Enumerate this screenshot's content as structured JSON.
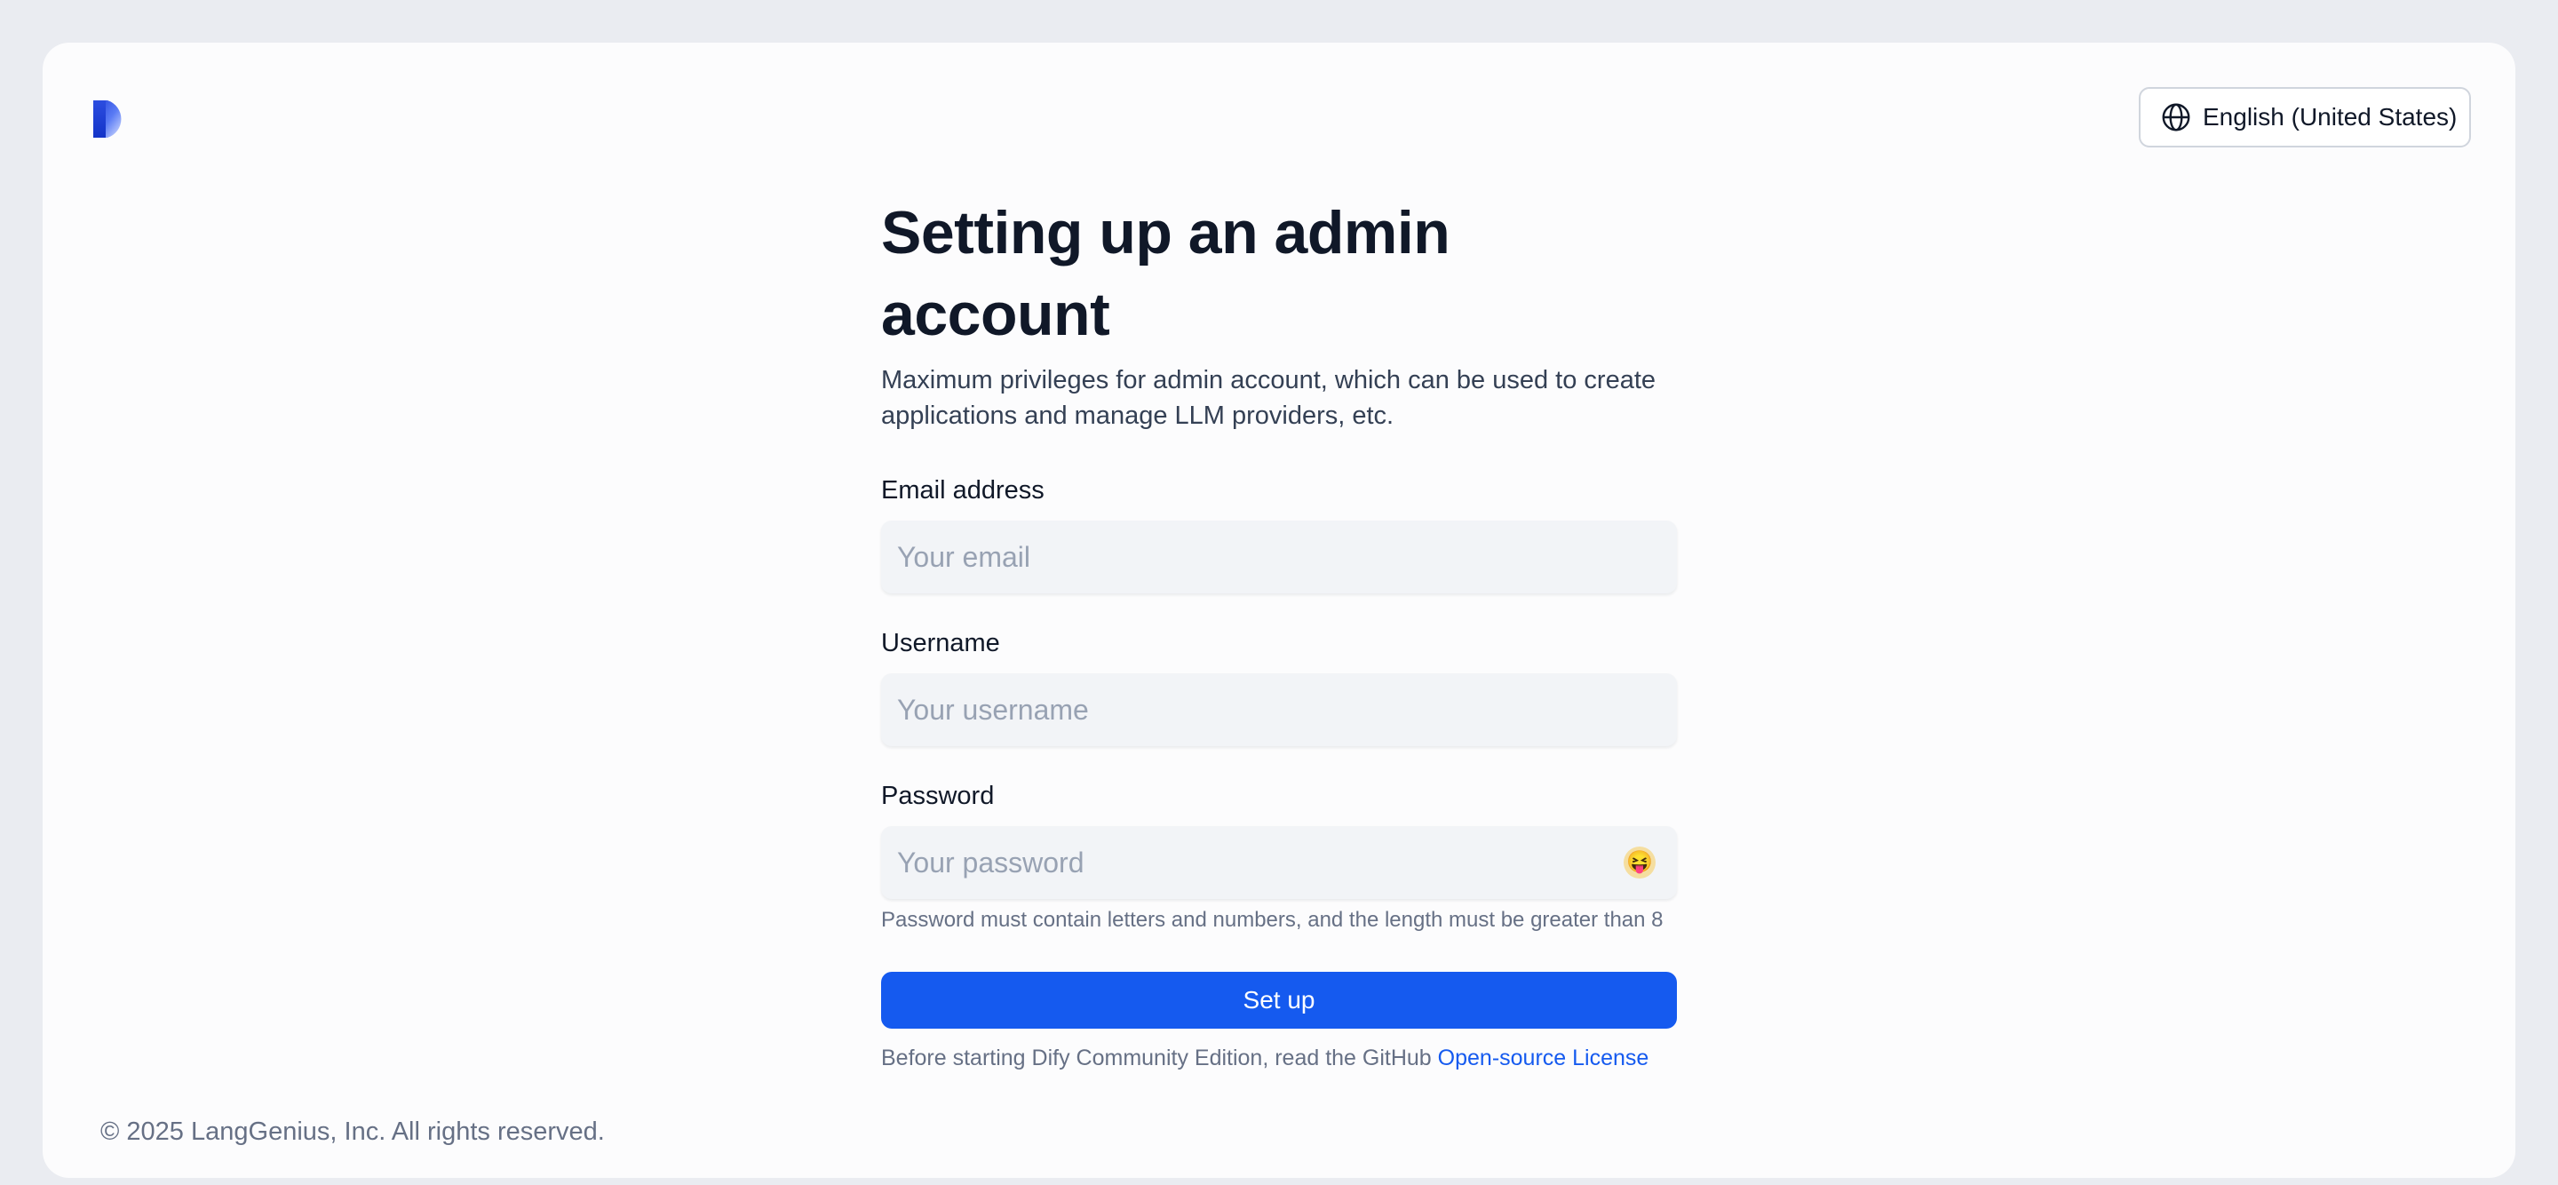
{
  "header": {
    "language_label": "English (United States)"
  },
  "page": {
    "title": "Setting up an admin account",
    "subtitle": "Maximum privileges for admin account, which can be used to create applications and manage LLM providers, etc."
  },
  "form": {
    "email": {
      "label": "Email address",
      "placeholder": "Your email",
      "value": ""
    },
    "username": {
      "label": "Username",
      "placeholder": "Your username",
      "value": ""
    },
    "password": {
      "label": "Password",
      "placeholder": "Your password",
      "value": "",
      "toggle_icon": "😝",
      "hint": "Password must contain letters and numbers, and the length must be greater than 8"
    },
    "submit_label": "Set up",
    "license_text": "Before starting Dify Community Edition, read the GitHub ",
    "license_link": "Open-source License"
  },
  "footer": {
    "copyright": "© 2025 LangGenius, Inc. All rights reserved."
  },
  "colors": {
    "accent": "#155aef",
    "page_bg": "#eaecf1",
    "card_bg": "#fcfcfd",
    "input_bg": "#f2f4f7"
  },
  "icons": {
    "logo": "dify-logo-icon",
    "language": "globe-icon",
    "password_toggle": "emoji-face-icon"
  }
}
